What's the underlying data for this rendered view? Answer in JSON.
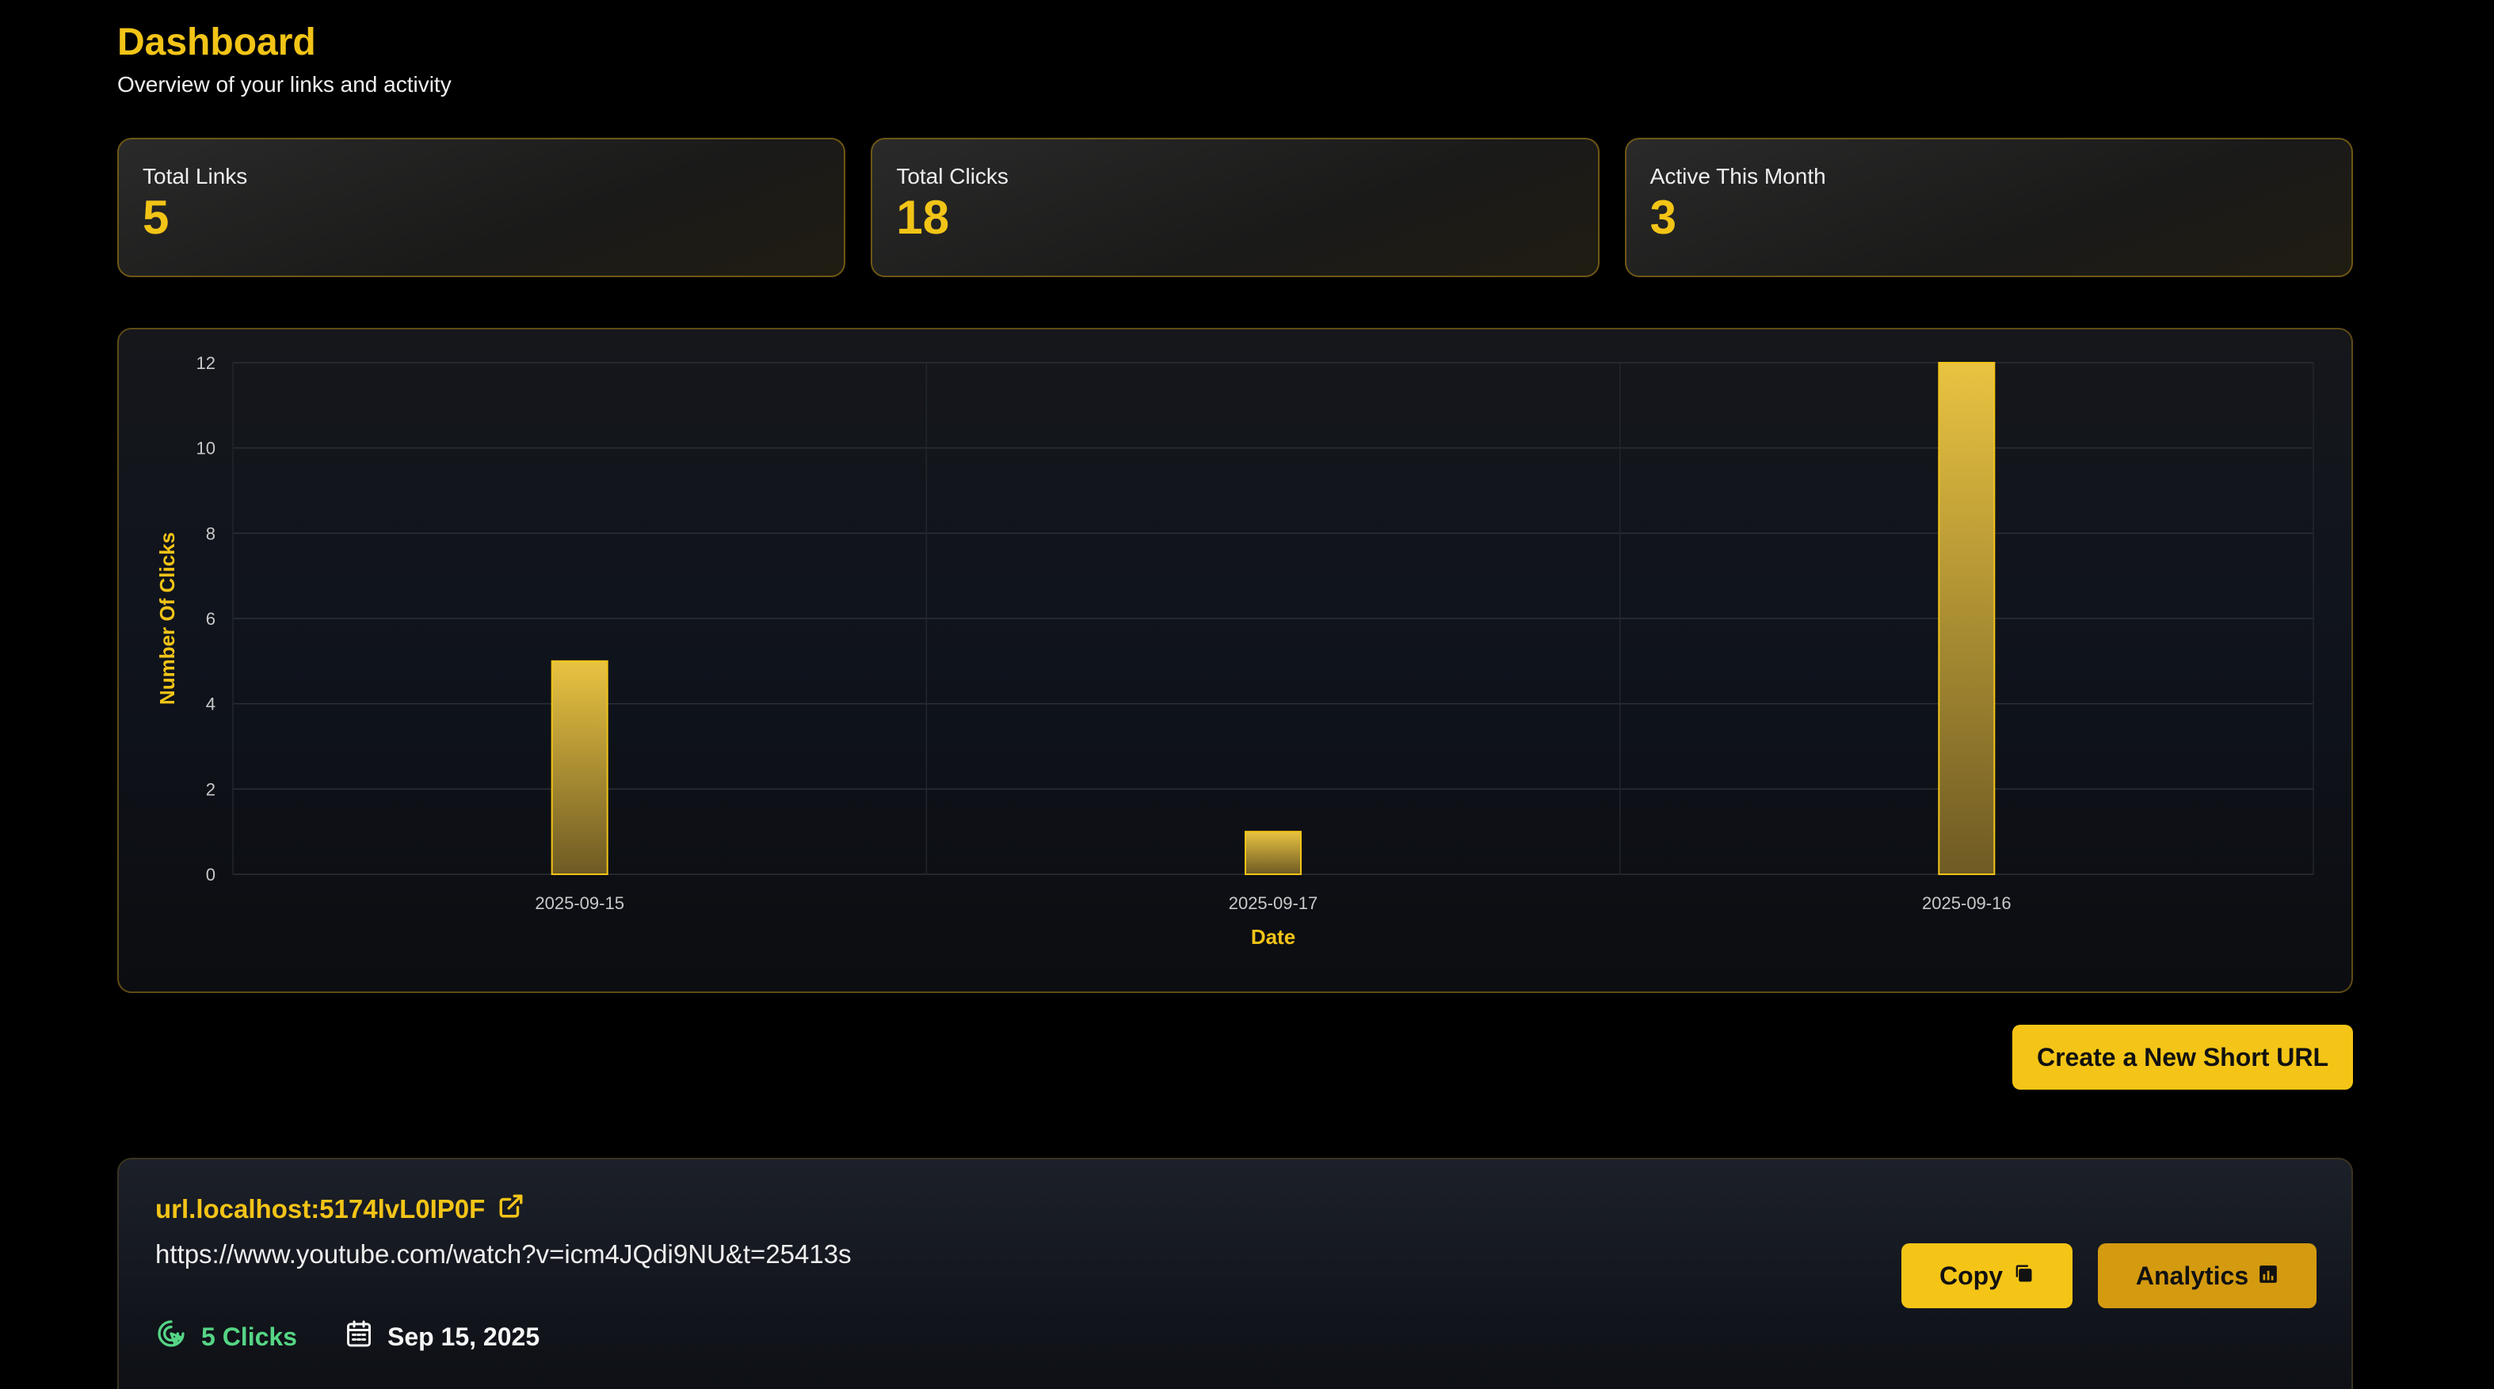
{
  "header": {
    "title": "Dashboard",
    "subtitle": "Overview of your links and activity"
  },
  "stats": [
    {
      "label": "Total Links",
      "value": "5"
    },
    {
      "label": "Total Clicks",
      "value": "18"
    },
    {
      "label": "Active This Month",
      "value": "3"
    }
  ],
  "chart_data": {
    "type": "bar",
    "categories": [
      "2025-09-15",
      "2025-09-17",
      "2025-09-16"
    ],
    "values": [
      5,
      1,
      12
    ],
    "title": "",
    "xlabel": "Date",
    "ylabel": "Number Of Clicks",
    "ylim": [
      0,
      12
    ],
    "yticks": [
      0,
      2,
      4,
      6,
      8,
      10,
      12
    ],
    "grid": true,
    "legend": "none",
    "bar_color": "#f2c417"
  },
  "actions": {
    "create_label": "Create a New Short URL"
  },
  "links": [
    {
      "short_url": "url.localhost:5174lvL0IP0F",
      "long_url": "https://www.youtube.com/watch?v=icm4JQdi9NU&t=25413s",
      "clicks": "5 Clicks",
      "date": "Sep 15, 2025",
      "copy_label": "Copy",
      "analytics_label": "Analytics",
      "icons": [
        "external-link-icon",
        "cursor-click-icon",
        "calendar-icon",
        "copy-icon",
        "bar-chart-icon"
      ]
    }
  ],
  "colors": {
    "accent": "#f2c417",
    "accent_dark": "#d49a10",
    "clicks_green": "#55d585",
    "background": "#000000"
  }
}
